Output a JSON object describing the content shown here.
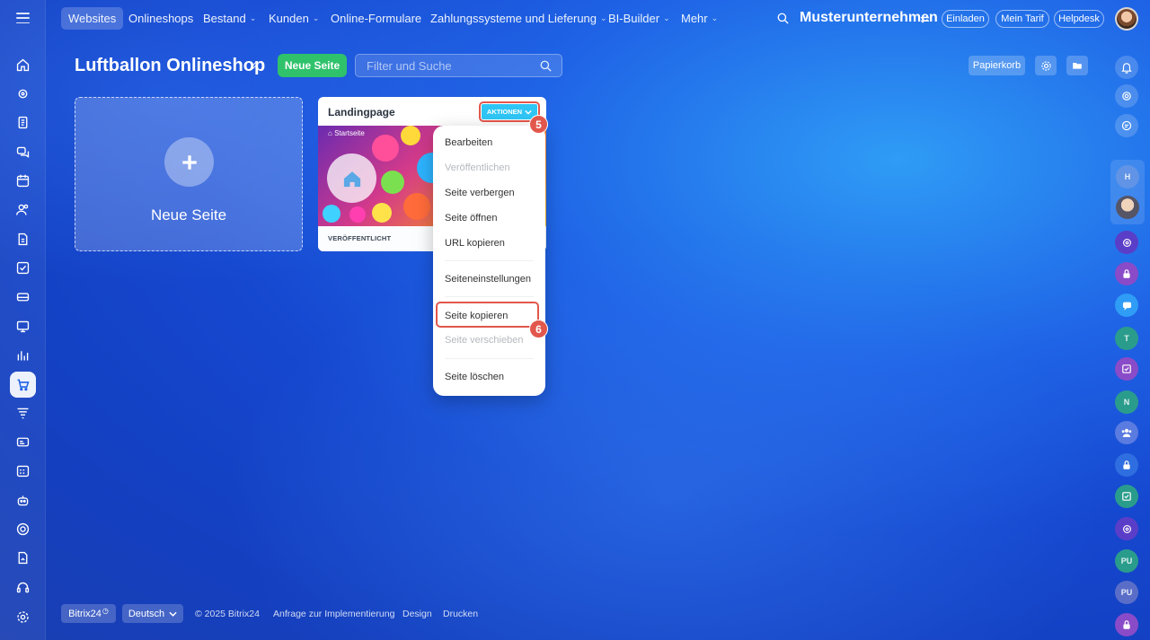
{
  "topnav": {
    "items": [
      {
        "label": "Websites"
      },
      {
        "label": "Onlineshops"
      },
      {
        "label": "Bestand"
      },
      {
        "label": "Kunden"
      },
      {
        "label": "Online-Formulare"
      },
      {
        "label": "Zahlungssysteme und Lieferung"
      },
      {
        "label": "BI-Builder"
      },
      {
        "label": "Mehr"
      }
    ],
    "company": "Musterunternehmen",
    "invite": "Einladen",
    "tariff": "Mein Tarif",
    "helpdesk": "Helpdesk"
  },
  "page": {
    "title": "Luftballon Onlineshop",
    "new_page_button": "Neue Seite",
    "search_placeholder": "Filter und Suche",
    "trash": "Papierkorb"
  },
  "new_card": {
    "label": "Neue Seite"
  },
  "page_card": {
    "title": "Landingpage",
    "actions": "AKTIONEN",
    "thumb_label": "Startseite",
    "status": "VERÖFFENTLICHT"
  },
  "menu": {
    "items": [
      {
        "label": "Bearbeiten"
      },
      {
        "label": "Veröffentlichen"
      },
      {
        "label": "Seite verbergen"
      },
      {
        "label": "Seite öffnen"
      },
      {
        "label": "URL kopieren"
      },
      {
        "label": "Seiteneinstellungen"
      },
      {
        "label": "Seite kopieren"
      },
      {
        "label": "Seite verschieben"
      },
      {
        "label": "Seite löschen"
      }
    ]
  },
  "annotations": {
    "step5": "5",
    "step6": "6"
  },
  "right_letters": {
    "h": "H",
    "t": "T",
    "n": "N",
    "pu1": "PU",
    "pu2": "PU"
  },
  "footer": {
    "brand": "Bitrix24",
    "language": "Deutsch",
    "copyright": "© 2025 Bitrix24",
    "link1": "Anfrage zur Implementierung",
    "link2": "Design",
    "link3": "Drucken"
  },
  "colors": {
    "accent_green": "#2fc26b",
    "actions_blue": "#2fc6f6",
    "annotation_red": "#e2574c"
  }
}
